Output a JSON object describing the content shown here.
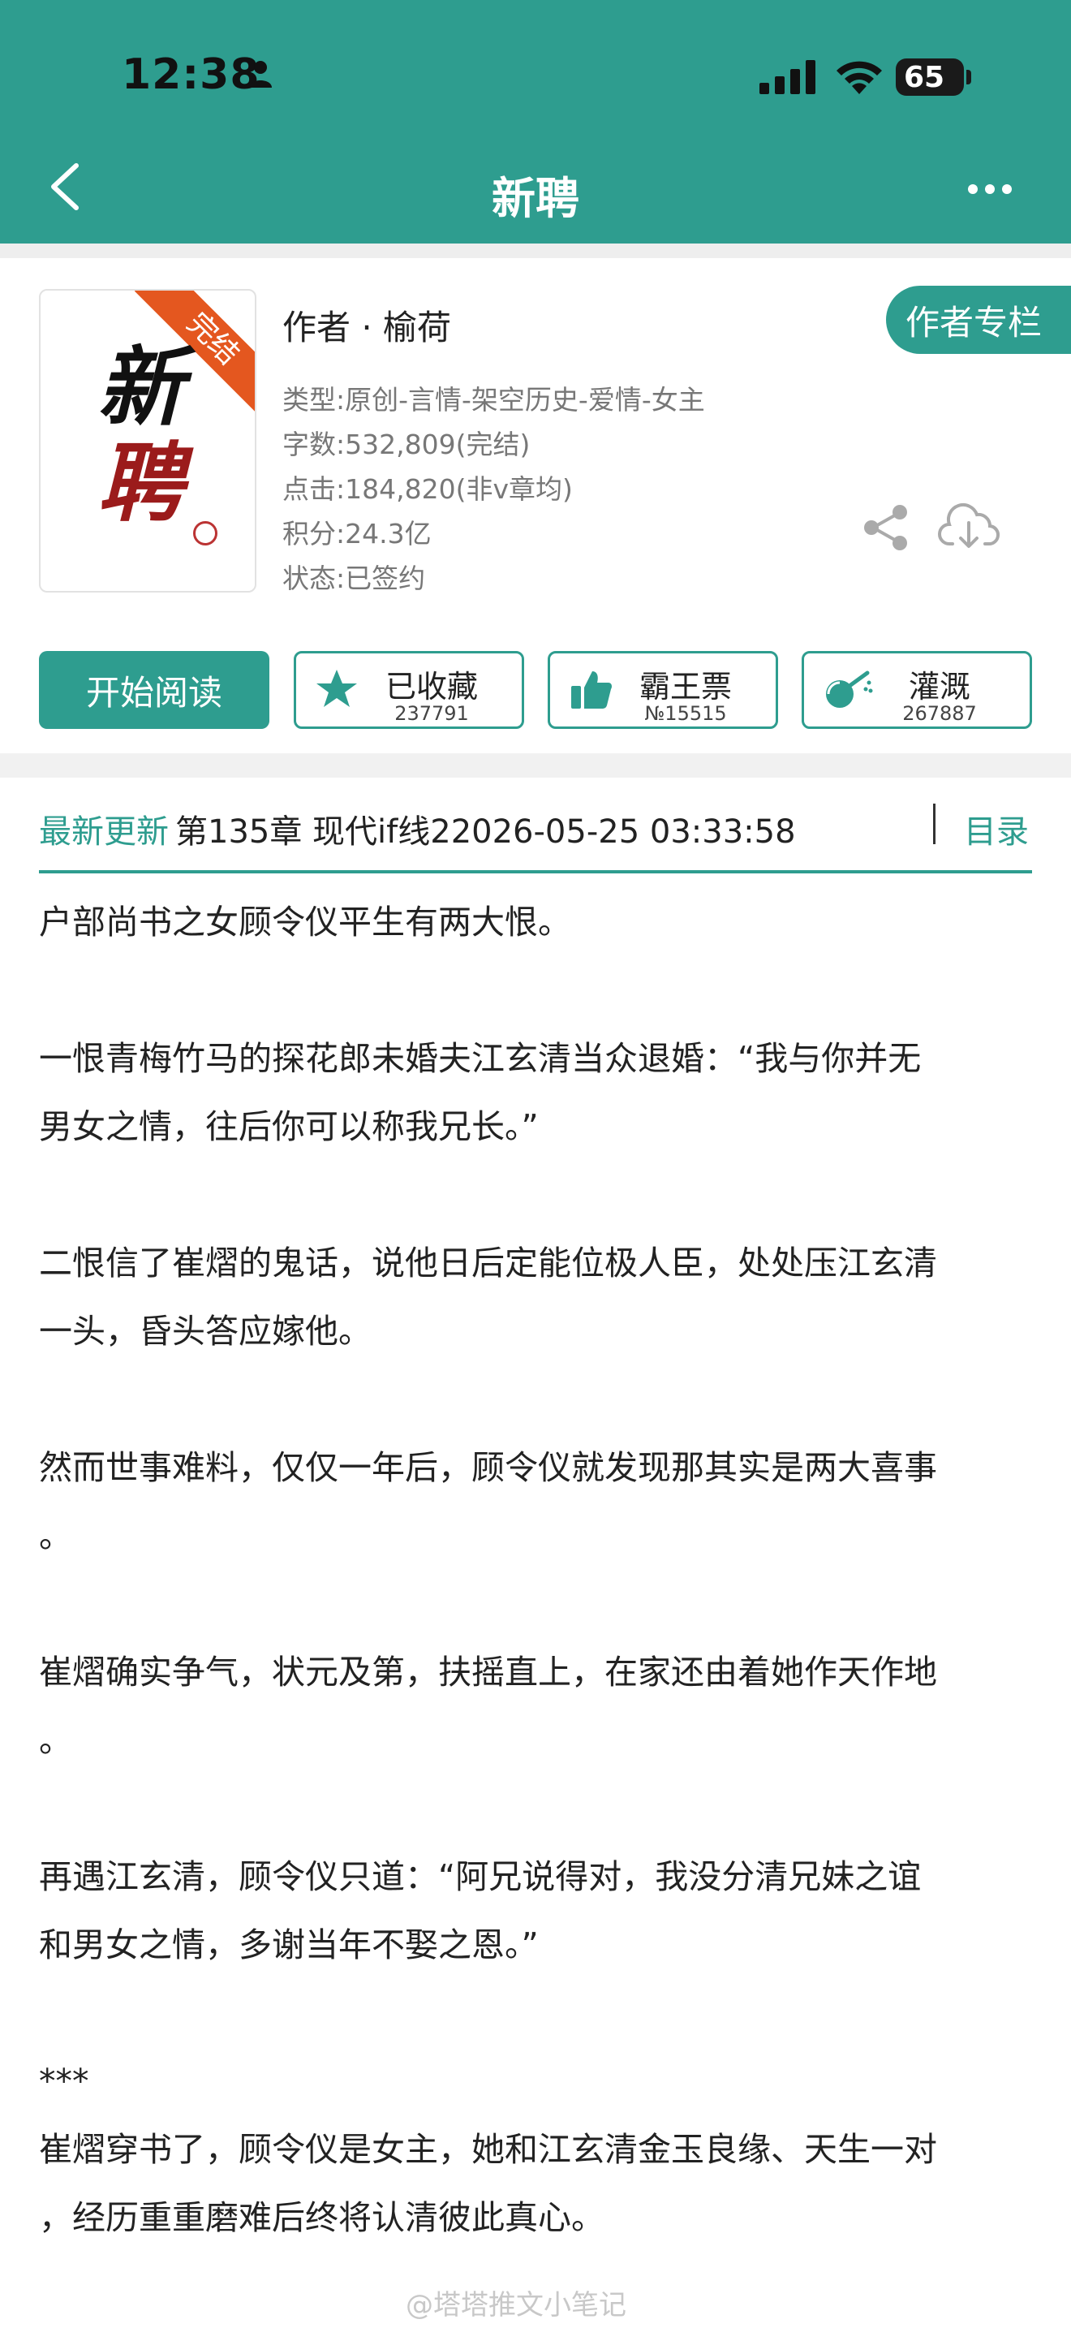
{
  "status_bar": {
    "time": "12:38",
    "battery": "65"
  },
  "nav": {
    "title": "新聘"
  },
  "book": {
    "cover_badge": "完结",
    "cover_title_top": "新",
    "cover_title_bottom": "聘",
    "author": "作者 · 榆荷",
    "author_column_button": "作者专栏",
    "info": [
      "类型:原创-言情-架空历史-爱情-女主",
      "字数:532,809(完结)",
      "点击:184,820(非v章均)",
      "积分:24.3亿",
      "状态:已签约"
    ]
  },
  "actions": {
    "read": "开始阅读",
    "collect": {
      "label": "已收藏",
      "count": "237791"
    },
    "vote": {
      "label": "霸王票",
      "count": "№15515"
    },
    "water": {
      "label": "灌溉",
      "count": "267887"
    }
  },
  "update": {
    "label": "最新更新",
    "text": "第135章 现代if线22026-05-25 03:33:58",
    "toc": "目录"
  },
  "synopsis": [
    "户部尚书之女顾令仪平生有两大恨。",
    "",
    "一恨青梅竹马的探花郎未婚夫江玄清当众退婚：“我与你并无",
    "男女之情，往后你可以称我兄长。”",
    "",
    "二恨信了崔熠的鬼话，说他日后定能位极人臣，处处压江玄清",
    "一头，昏头答应嫁他。",
    "",
    "然而世事难料，仅仅一年后，顾令仪就发现那其实是两大喜事",
    "。",
    "",
    "崔熠确实争气，状元及第，扶摇直上，在家还由着她作天作地",
    "。",
    "",
    "再遇江玄清，顾令仪只道：“阿兄说得对，我没分清兄妹之谊",
    "和男女之情，多谢当年不娶之恩。”",
    "",
    "***",
    "崔熠穿书了，顾令仪是女主，她和江玄清金玉良缘、天生一对",
    "，经历重重磨难后终将认清彼此真心。"
  ],
  "watermark": "@塔塔推文小笔记"
}
